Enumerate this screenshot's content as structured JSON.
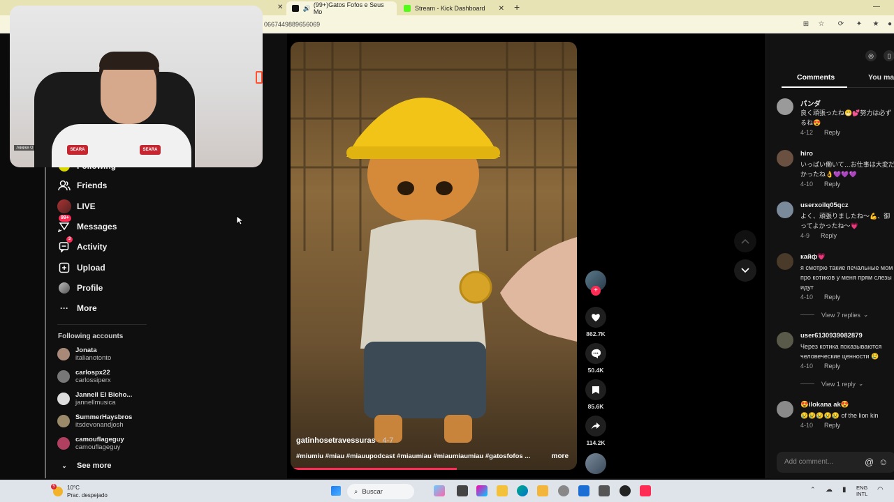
{
  "browser": {
    "tabs": [
      {
        "label": "(99+)Gatos Fofos e Seus Mo",
        "active": true
      },
      {
        "label": "Stream - Kick Dashboard",
        "active": false
      }
    ],
    "new_tab": "+",
    "url_fragment": "0667449889656069"
  },
  "sidebar": {
    "items": [
      {
        "label": "Following",
        "icon": "following-icon"
      },
      {
        "label": "Friends",
        "icon": "friends-icon"
      },
      {
        "label": "LIVE",
        "icon": "live-avatar"
      },
      {
        "label": "Messages",
        "icon": "messages-icon",
        "badge": "99+"
      },
      {
        "label": "Activity",
        "icon": "activity-icon",
        "badge": "3"
      },
      {
        "label": "Upload",
        "icon": "upload-icon"
      },
      {
        "label": "Profile",
        "icon": "profile-avatar"
      },
      {
        "label": "More",
        "icon": "more-icon"
      }
    ],
    "following_title": "Following accounts",
    "accounts": [
      {
        "name": "Jonata",
        "handle": "italianotonto"
      },
      {
        "name": "carlospx22",
        "handle": "carlossiperx"
      },
      {
        "name": "Jannell El Bicho...",
        "handle": "jannellmusica"
      },
      {
        "name": "SummerHaysbros",
        "handle": "itsdevonandjosh"
      },
      {
        "name": "camouflageguy",
        "handle": "camouflageguy"
      }
    ],
    "see_more": "See more"
  },
  "video": {
    "author": "gatinhosetravessuras",
    "date": " · 4-7",
    "tags": "#miumiu #miau #miauupodcast #miaumiau #miaumiaumiau #gatosfofos ...",
    "more": "more",
    "progress": 0.58
  },
  "actions": {
    "likes": "862.7K",
    "comments": "50.4K",
    "saves": "85.6K",
    "shares": "114.2K"
  },
  "comments_panel": {
    "tab_comments": "Comments",
    "tab_you_may": "You may",
    "comments": [
      {
        "user": "パンダ",
        "text": "良く頑張ったね😁💕努力は必ず\nるね😍",
        "date": "4-12",
        "reply": "Reply"
      },
      {
        "user": "hiro",
        "text": "いっぱい働いて…お仕事は大変だ\nかったね👌💜💜💜",
        "date": "4-10",
        "reply": "Reply"
      },
      {
        "user": "userxoilq05qcz",
        "text": "よく、頑張りましたね〜💪、御\nってよかったね〜💗",
        "date": "4-9",
        "reply": "Reply"
      },
      {
        "user": "кайф💗",
        "text": "я смотрю такие печальные мом\nпро котиков у меня прям слезы\nидут",
        "date": "4-10",
        "reply": "Reply"
      },
      {
        "user": "user6130939082879",
        "text": "Через котика показываются\nчеловеческие ценности 😢",
        "date": "4-10",
        "reply": "Reply"
      },
      {
        "user": "😍ilokana ak😍",
        "text": "😢😢😢😢😢 of the lion kin",
        "date": "4-10",
        "reply": "Reply"
      }
    ],
    "view_replies_1": "View 7 replies",
    "view_replies_2": "View 1 reply",
    "add_comment_placeholder": "Add comment..."
  },
  "webcam": {
    "overlay_tag": "Jajajaja Q",
    "shirt_logo": "SEARA"
  },
  "taskbar": {
    "temp": "10°C",
    "weather": "Prac. despejado",
    "weather_badge": "5",
    "search": "Buscar",
    "lang1": "ENG",
    "lang2": "INTL"
  },
  "colors": {
    "accent": "#fe2c55",
    "tab_strip": "#e7e3b5"
  }
}
